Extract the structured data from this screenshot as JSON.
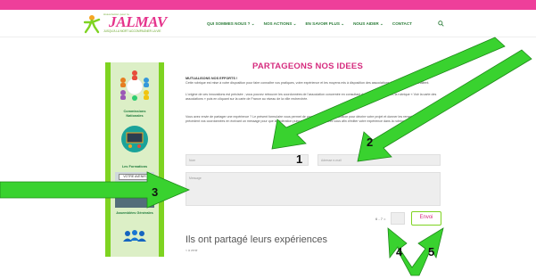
{
  "header": {
    "logo_small": "Association pour le",
    "logo_word": "JALMAV",
    "logo_tagline": "JUSQU'A LA MORT ACCOMPAGNER LA VIE",
    "nav": [
      {
        "label": "QUI SOMMES NOUS ? ⌄"
      },
      {
        "label": "NOS ACTIONS ⌄"
      },
      {
        "label": "EN SAVOIR PLUS ⌄"
      },
      {
        "label": "NOUS AIDER ⌄"
      },
      {
        "label": "CONTACT"
      }
    ],
    "search_icon": "search-icon"
  },
  "sidebar": {
    "items": [
      {
        "label": "Commissions Nationales",
        "icon": "people-circle-icon"
      },
      {
        "label": "Les Formations",
        "icon": "training-board-icon"
      },
      {
        "label": "Assemblées Générales",
        "icon": "meeting-photo-icon",
        "banner": "VOTRE AVENIR"
      },
      {
        "label": "",
        "icon": "group-people-icon"
      }
    ]
  },
  "main": {
    "title": "PARTAGEONS NOS IDEES",
    "heading": "MUTUALISONS NOS EFFORTS !",
    "paragraph1": "Cette rubrique est mise à votre disposition pour faire connaître vos pratiques, votre expérience et les moyens mis à disposition des associations JALMALV qui le souhaitent.",
    "paragraph2": "L'origine de ces innovations est précisée ; vous pouvez retrouver les coordonnées de l'association concernée en consultant dans la page d'accueil, la rubrique « Voir la carte des associations » puis en cliquant sur la carte de France au niveau de la ville recherchée.",
    "paragraph3": "Vous avez envie de partager une expérience ? Le présent formulaire vous permet de vous adresser à la fédération pour décrire votre projet et donner les renseignements qui précèdent vos coordonnées en écrivant un message pour que la fédération puisse prendre contact avec vous afin d'éditer votre expérience dans la rubrique ci-dessous."
  },
  "form": {
    "name_placeholder": "Nom",
    "email_placeholder": "Adresse e-mail",
    "message_placeholder": "Message",
    "captcha_question": "6 - 7 =",
    "submit_label": "Envoi"
  },
  "experiences": {
    "title": "Ils ont partagé leurs expériences",
    "link": "< à venir"
  },
  "annotations": {
    "arrow_color": "#39d22f",
    "labels": [
      "1",
      "2",
      "3",
      "4",
      "5"
    ]
  }
}
